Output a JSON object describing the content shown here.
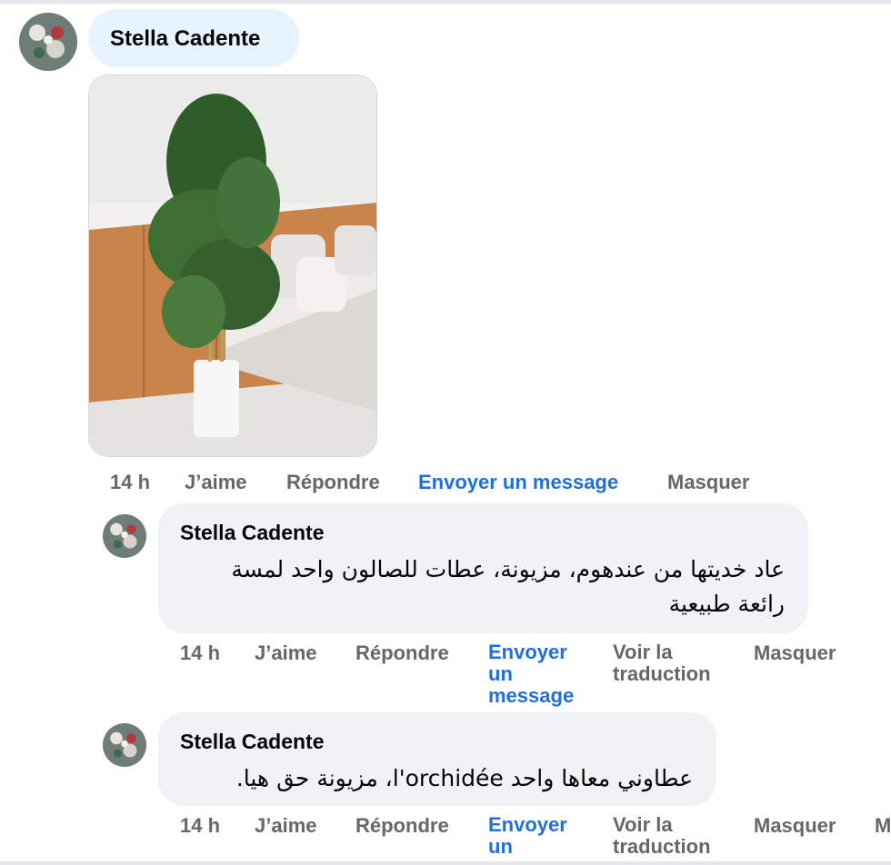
{
  "post": {
    "author": "Stella Cadente",
    "image_alt": "Artificial bamboo plant in a white pot next to a white sofa",
    "actions": {
      "time": "14 h",
      "like": "J’aime",
      "reply": "Répondre",
      "message": "Envoyer un message",
      "hide": "Masquer"
    }
  },
  "replies": [
    {
      "author": "Stella Cadente",
      "text": "عاد خديتها من عندهوم، مزيونة، عطات للصالون واحد لمسة رائعة طبيعية",
      "actions": {
        "time": "14 h",
        "like": "J’aime",
        "reply": "Répondre",
        "message": "Envoyer un message",
        "translate": "Voir la traduction",
        "hide": "Masquer"
      }
    },
    {
      "author": "Stella Cadente",
      "text": "عطاوني معاها واحد l'orchidée، مزيونة حق هيا.",
      "actions": {
        "time": "14 h",
        "like": "J’aime",
        "reply": "Répondre",
        "message": "Envoyer un",
        "translate": "Voir la traduction",
        "hide": "Masquer",
        "overflow": "M"
      }
    }
  ],
  "colors": {
    "link": "#216fdb",
    "muted": "#65676b",
    "bubble": "#f0f2f5",
    "name_bubble": "#e7f3ff"
  }
}
